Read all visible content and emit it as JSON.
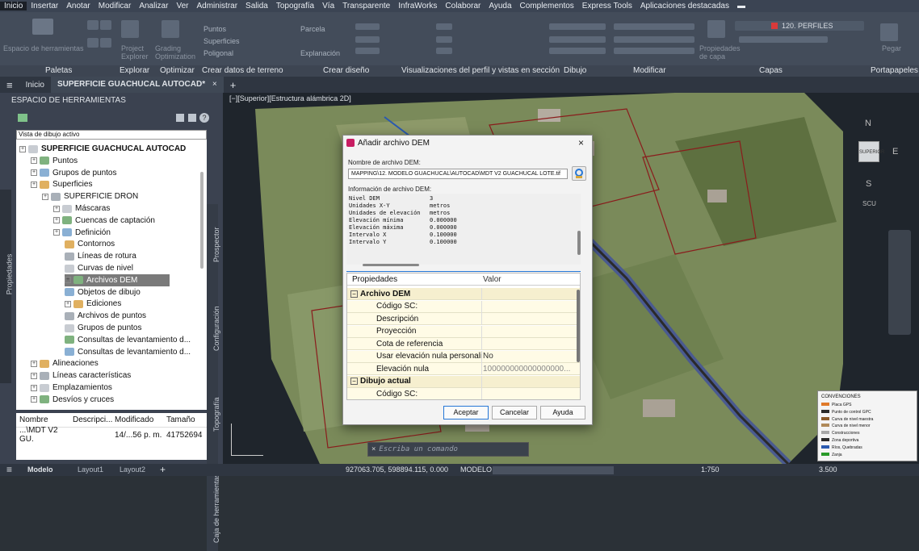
{
  "menu": [
    "Inicio",
    "Insertar",
    "Anotar",
    "Modificar",
    "Analizar",
    "Ver",
    "Administrar",
    "Salida",
    "Topografía",
    "Vía",
    "Transparente",
    "InfraWorks",
    "Colaborar",
    "Ayuda",
    "Complementos",
    "Express Tools",
    "Aplicaciones destacadas"
  ],
  "ribbon": {
    "tool_labels": {
      "espacio": "Espacio de herramientas",
      "project": "Project Explorer",
      "grading": "Grading Optimization",
      "puntos": "Puntos",
      "superficies": "Superficies",
      "poligonal": "Poligonal",
      "parcela": "Parcela",
      "explanacion": "Explanación",
      "propiedades": "Propiedades de capa",
      "perfiles": "120. PERFILES",
      "pegar": "Pegar"
    },
    "groups": [
      "Paletas",
      "Explorar",
      "Optimizar",
      "Crear datos de terreno",
      "Crear diseño",
      "Visualizaciones del perfil y vistas en sección",
      "Dibujo",
      "Modificar",
      "Capas",
      "Portapapeles"
    ]
  },
  "tabs": {
    "home": "Inicio",
    "doc": "SUPERFICIE GUACHUCAL AUTOCAD*",
    "close": "×",
    "add": "+"
  },
  "toolspace": {
    "title": "ESPACIO DE HERRAMIENTAS",
    "side_label": "Propiedades",
    "view_select": "Vista de dibujo activo",
    "tree": [
      {
        "label": "SUPERFICIE GUACHUCAL AUTOCAD",
        "depth": 0,
        "bold": true
      },
      {
        "label": "Puntos",
        "depth": 1
      },
      {
        "label": "Grupos de puntos",
        "depth": 1
      },
      {
        "label": "Superficies",
        "depth": 1
      },
      {
        "label": "SUPERFICIE DRON",
        "depth": 2
      },
      {
        "label": "Máscaras",
        "depth": 3
      },
      {
        "label": "Cuencas de captación",
        "depth": 3
      },
      {
        "label": "Definición",
        "depth": 3
      },
      {
        "label": "Contornos",
        "depth": 4
      },
      {
        "label": "Líneas de rotura",
        "depth": 4
      },
      {
        "label": "Curvas de nivel",
        "depth": 4
      },
      {
        "label": "Archivos DEM",
        "depth": 4,
        "selected": true
      },
      {
        "label": "Objetos de dibujo",
        "depth": 4
      },
      {
        "label": "Ediciones",
        "depth": 4
      },
      {
        "label": "Archivos de puntos",
        "depth": 4
      },
      {
        "label": "Grupos de puntos",
        "depth": 4
      },
      {
        "label": "Consultas de levantamiento d...",
        "depth": 4
      },
      {
        "label": "Consultas de levantamiento d...",
        "depth": 4
      },
      {
        "label": "Alineaciones",
        "depth": 1
      },
      {
        "label": "Líneas características",
        "depth": 1
      },
      {
        "label": "Emplazamientos",
        "depth": 1
      },
      {
        "label": "Desvíos y cruces",
        "depth": 1
      }
    ],
    "vtabs": [
      "Prospector",
      "Configuración",
      "Topografía",
      "Caja de herramientas"
    ],
    "list_headers": [
      "Nombre",
      "Descripci...",
      "Modificado",
      "Tamaño"
    ],
    "list_row": [
      "...\\MDT V2 GU.",
      "",
      "14/...56 p. m.",
      "41752694"
    ]
  },
  "viewport": {
    "label": "[−][Superior][Estructura alámbrica 2D]",
    "viewcube_top": "N",
    "viewcube_face": "SUPERIOR",
    "viewcube_east": "E",
    "viewcube_south": "S",
    "ucs": "SCU",
    "cmd_placeholder": "Escriba un comando",
    "legend_title": "CONVENCIONES",
    "legend_items": [
      "Placa GPS",
      "Punto de control GPC",
      "Curva de nivel maestra",
      "Curva de nivel menor",
      "Construcciones",
      "Zona deportiva",
      "Ríos, Quebradas",
      "Zanja"
    ]
  },
  "dialog": {
    "title": "Añadir archivo DEM",
    "close": "×",
    "file_label": "Nombre de archivo DEM:",
    "file_path": "MAPPING\\12. MODELO GUACHUCAL\\AUTOCAD\\MDT V2 GUACHUCAL LOTE.tif",
    "info_label": "Información de archivo DEM:",
    "info": [
      {
        "k": "Nivel DEM",
        "v": "3"
      },
      {
        "k": "Unidades X-Y",
        "v": "metros"
      },
      {
        "k": "Unidades de elevación",
        "v": "metros"
      },
      {
        "k": "Elevación mínima",
        "v": "0.000000"
      },
      {
        "k": "Elevación máxima",
        "v": "0.000000"
      },
      {
        "k": "Intervalo X",
        "v": "0.100000"
      },
      {
        "k": "Intervalo Y",
        "v": "0.100000"
      }
    ],
    "props_headers": [
      "Propiedades",
      "Valor"
    ],
    "props": [
      {
        "k": "Archivo DEM",
        "v": "",
        "cat": true
      },
      {
        "k": "Código SC:",
        "v": ""
      },
      {
        "k": "Descripción",
        "v": ""
      },
      {
        "k": "Proyección",
        "v": ""
      },
      {
        "k": "Cota de referencia",
        "v": ""
      },
      {
        "k": "Usar elevación nula personaliz...",
        "v": "No"
      },
      {
        "k": "Elevación nula",
        "v": "100000000000000000..."
      },
      {
        "k": "Dibujo actual",
        "v": "",
        "cat": true
      },
      {
        "k": "Código SC:",
        "v": ""
      }
    ],
    "buttons": {
      "ok": "Aceptar",
      "cancel": "Cancelar",
      "help": "Ayuda"
    }
  },
  "status": {
    "model_tab": "Modelo",
    "layout1": "Layout1",
    "layout2": "Layout2",
    "add": "+",
    "coords": "927063.705, 598894.115, 0.000",
    "mode": "MODELO",
    "scale": "1:750",
    "value": "3.500"
  },
  "colors": {
    "accent": "#2677d6",
    "dialog_logo": "#c81d62",
    "selected_tree": "#7a7a7a",
    "layer_red": "#d93a3a"
  }
}
